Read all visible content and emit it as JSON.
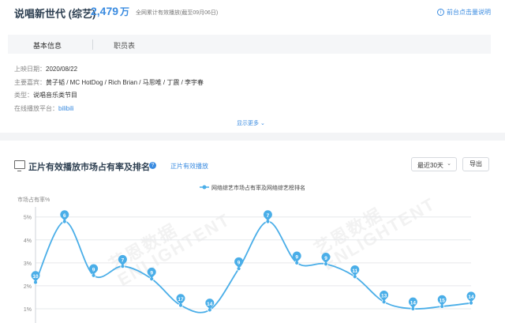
{
  "header": {
    "title": "说唱新世代 (综艺)",
    "views": "2,479",
    "views_unit": "万",
    "views_note": "全网累计有效播放(截至09月06日)",
    "help_link": "前台点击量说明"
  },
  "tabs": [
    {
      "label": "基本信息",
      "active": true
    },
    {
      "label": "职员表",
      "active": false
    }
  ],
  "info": [
    {
      "key": "上映日期：",
      "value": "2020/08/22"
    },
    {
      "key": "主要嘉宾：",
      "value": "黄子韬 / MC HotDog / Rich Brian / 马思唯 / 丁震 / 李宇春"
    },
    {
      "key": "类型：",
      "value": "说唱音乐类节目"
    },
    {
      "key": "在线播放平台：",
      "value": "bilibili"
    }
  ],
  "show_more": "显示更多",
  "chart_section": {
    "title": "正片有效播放市场占有率及排名",
    "help_icon": "?",
    "link": "正片有效播放",
    "range_select": "最近30天",
    "export": "导出"
  },
  "watermark": {
    "line1": "艺恩数据",
    "line2": "ENLIGHTENT"
  },
  "colors": {
    "accent": "#3a8be0",
    "line": "#4aaee8"
  },
  "chart_data": {
    "type": "line",
    "ylabel": "市场占有率%",
    "y_ticks": [
      "5%",
      "4%",
      "3%",
      "2%",
      "1%"
    ],
    "ylim": [
      0,
      5.3
    ],
    "grid": true,
    "legend": "top-center",
    "series": [
      {
        "name": "网络综艺市场占有率及网络综艺榜排名",
        "values": [
          2.15,
          4.8,
          2.45,
          2.85,
          2.3,
          1.15,
          0.95,
          2.75,
          4.8,
          3.0,
          2.95,
          2.4,
          1.3,
          1.0,
          1.1,
          1.25
        ],
        "ranks": [
          10,
          6,
          9,
          7,
          9,
          17,
          14,
          9,
          7,
          9,
          9,
          11,
          13,
          14,
          15,
          14
        ]
      }
    ]
  }
}
